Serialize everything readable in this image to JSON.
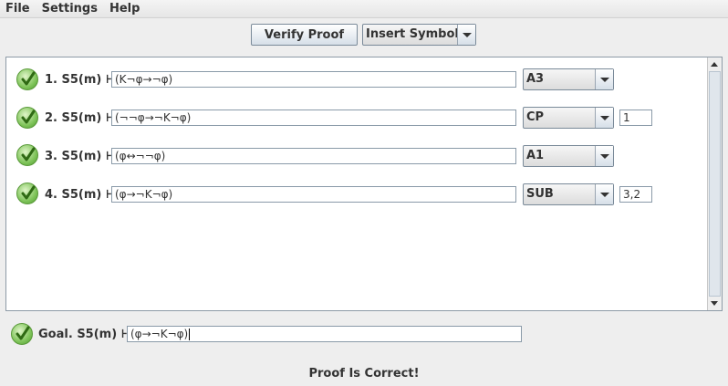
{
  "menu": {
    "items": [
      {
        "label": "File"
      },
      {
        "label": "Settings"
      },
      {
        "label": "Help"
      }
    ]
  },
  "toolbar": {
    "verify_label": "Verify Proof",
    "insert_symbol_label": "Insert Symbol"
  },
  "proof": {
    "steps": [
      {
        "number": "1.",
        "system": "S5(m)",
        "turnstile": "⊦",
        "formula": "(K¬φ→¬φ)",
        "rule": "A3",
        "refs": "",
        "status_icon": "check-icon"
      },
      {
        "number": "2.",
        "system": "S5(m)",
        "turnstile": "⊦",
        "formula": "(¬¬φ→¬K¬φ)",
        "rule": "CP",
        "refs": "1",
        "status_icon": "check-icon"
      },
      {
        "number": "3.",
        "system": "S5(m)",
        "turnstile": "⊦",
        "formula": "(φ↔¬¬φ)",
        "rule": "A1",
        "refs": "",
        "status_icon": "check-icon"
      },
      {
        "number": "4.",
        "system": "S5(m)",
        "turnstile": "⊦",
        "formula": "(φ→¬K¬φ)",
        "rule": "SUB",
        "refs": "3,2",
        "status_icon": "check-icon"
      }
    ]
  },
  "goal": {
    "label": "Goal.",
    "system": "S5(m)",
    "turnstile": "⊦",
    "formula": "(φ→¬K¬φ)"
  },
  "status": {
    "message": "Proof Is Correct!"
  },
  "colors": {
    "check_green": "#4e9a2f",
    "background": "#eeeeee"
  }
}
